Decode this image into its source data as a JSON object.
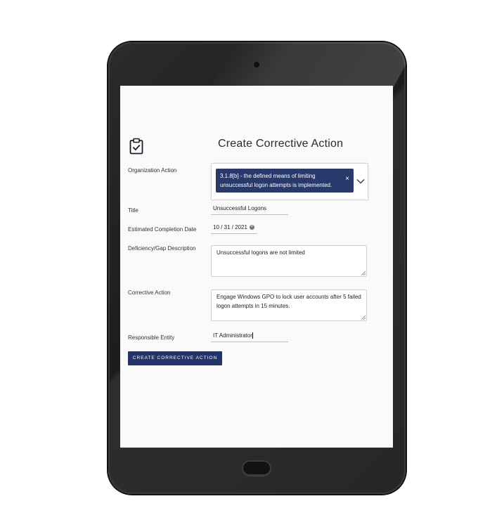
{
  "page": {
    "title": "Create Corrective Action",
    "icon": "clipboard-check-icon"
  },
  "form": {
    "organization_action": {
      "label": "Organization Action",
      "selected_line1": "3.1.8[b] - the defined means of limiting",
      "selected_line2": "unsuccessful logon attempts is implemented.",
      "remove_glyph": "×"
    },
    "title": {
      "label": "Title",
      "value": "Unsuccessful Logons"
    },
    "completion_date": {
      "label": "Estimated Completion Date",
      "value": "10 / 31 / 2021"
    },
    "deficiency": {
      "label": "Deficiency/Gap Description",
      "value": "Unsuccessful logons are not limited"
    },
    "corrective_action": {
      "label": "Corrective Action",
      "value_line1": "Engage Windows GPO to lock user accounts after 5 failed",
      "value_line2": "logon attempts in 15 minutes."
    },
    "responsible_entity": {
      "label": "Responsible Entity",
      "value": "IT Administrator"
    },
    "submit_label": "CREATE CORRECTIVE ACTION"
  },
  "colors": {
    "accent": "#233468",
    "chip": "#283a6b",
    "device_frame": "#1f1f1f"
  }
}
